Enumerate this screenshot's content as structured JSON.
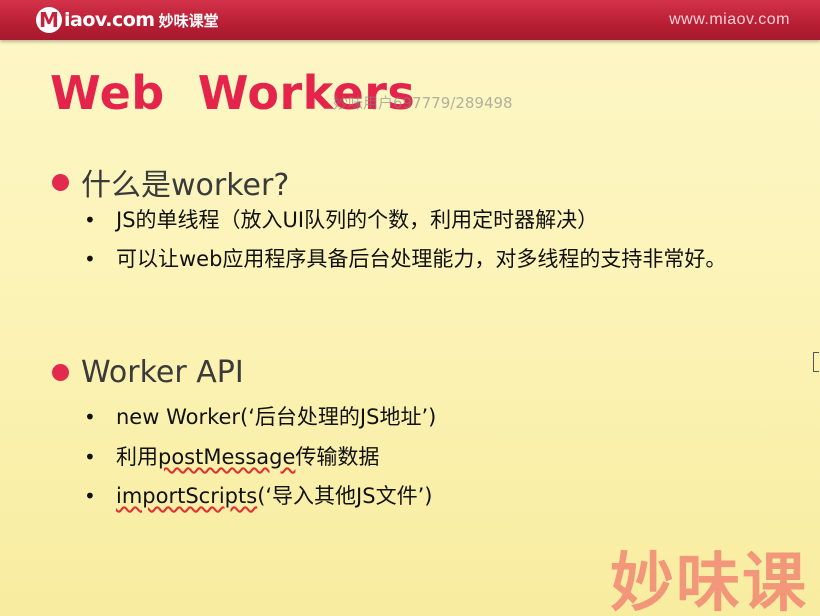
{
  "header": {
    "logo_letter": "M",
    "logo_text": "iaov.com",
    "logo_cn": "妙味课堂",
    "site": "www.miaov.com"
  },
  "title": "Web  Workers",
  "watermark": "妙味用户697779/289498",
  "sections": [
    {
      "heading": "什么是worker?",
      "items": [
        {
          "text": "JS的单线程（放入UI队列的个数，利用定时器解决）"
        },
        {
          "text": "可以让web应用程序具备后台处理能力，对多线程的支持非常好。"
        }
      ]
    },
    {
      "heading": "Worker API",
      "items": [
        {
          "text": "new Worker(‘后台处理的JS地址’)"
        },
        {
          "pre": "利用",
          "underlined": "postMessage",
          "post": "传输数据"
        },
        {
          "underlined": "importScripts",
          "post": "(‘导入其他JS文件’)"
        }
      ]
    }
  ],
  "corner_watermark": "妙味课",
  "colors": {
    "header_red": "#c4233b",
    "title_red": "#e5244b",
    "background": "#fbf3b5"
  }
}
